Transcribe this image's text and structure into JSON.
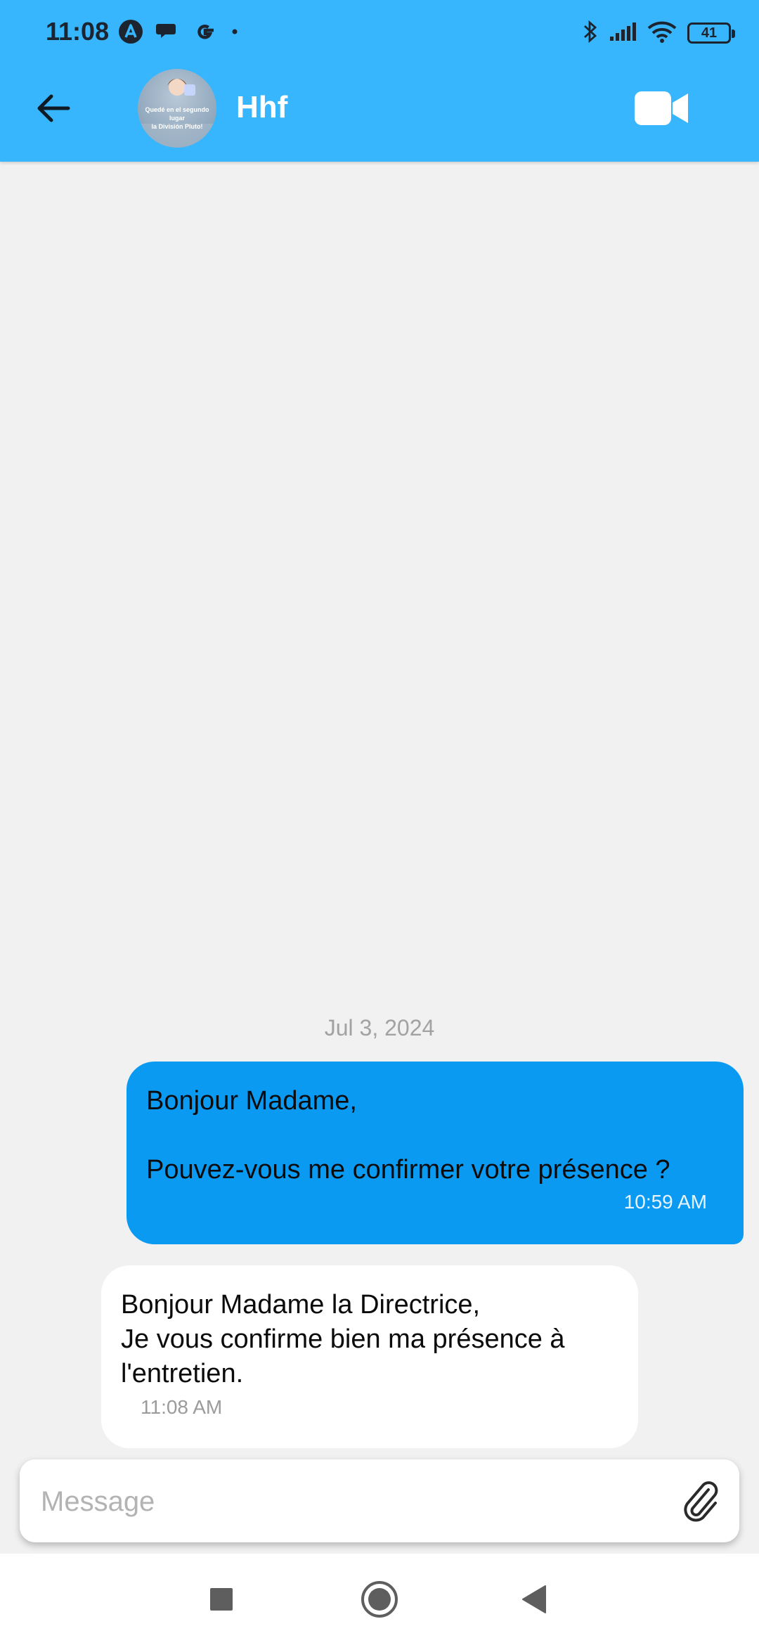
{
  "status_bar": {
    "time": "11:08",
    "battery": "41",
    "left_icons": [
      "app-a-icon",
      "chat-bubbles-icon",
      "google-icon",
      "dot-icon"
    ],
    "right_icons": [
      "bluetooth-icon",
      "signal-icon",
      "wifi-icon",
      "battery-icon"
    ]
  },
  "header": {
    "contact_name": "Hhf",
    "avatar_caption": "Quedé en el segundo lugar\nla División Pluto!",
    "back_icon": "arrow-left-icon",
    "video_icon": "video-camera-icon"
  },
  "conversation": {
    "date_separator": "Jul 3, 2024",
    "messages": [
      {
        "direction": "outgoing",
        "text": "Bonjour Madame,\n\nPouvez-vous me confirmer votre présence ?",
        "time": "10:59 AM"
      },
      {
        "direction": "incoming",
        "text": "Bonjour Madame la Directrice,\nJe vous confirme bien ma présence à l'entretien.",
        "time": "11:08 AM"
      }
    ]
  },
  "composer": {
    "placeholder": "Message",
    "value": "",
    "attach_icon": "paperclip-icon"
  },
  "nav_bar": {
    "buttons": [
      "recents-square-icon",
      "home-circle-icon",
      "back-triangle-icon"
    ]
  },
  "colors": {
    "header": "#38b6fd",
    "outgoing_bubble": "#0a9af2",
    "incoming_bubble": "#ffffff",
    "background": "#f1f1f1",
    "date_text": "#a2a2a2"
  }
}
